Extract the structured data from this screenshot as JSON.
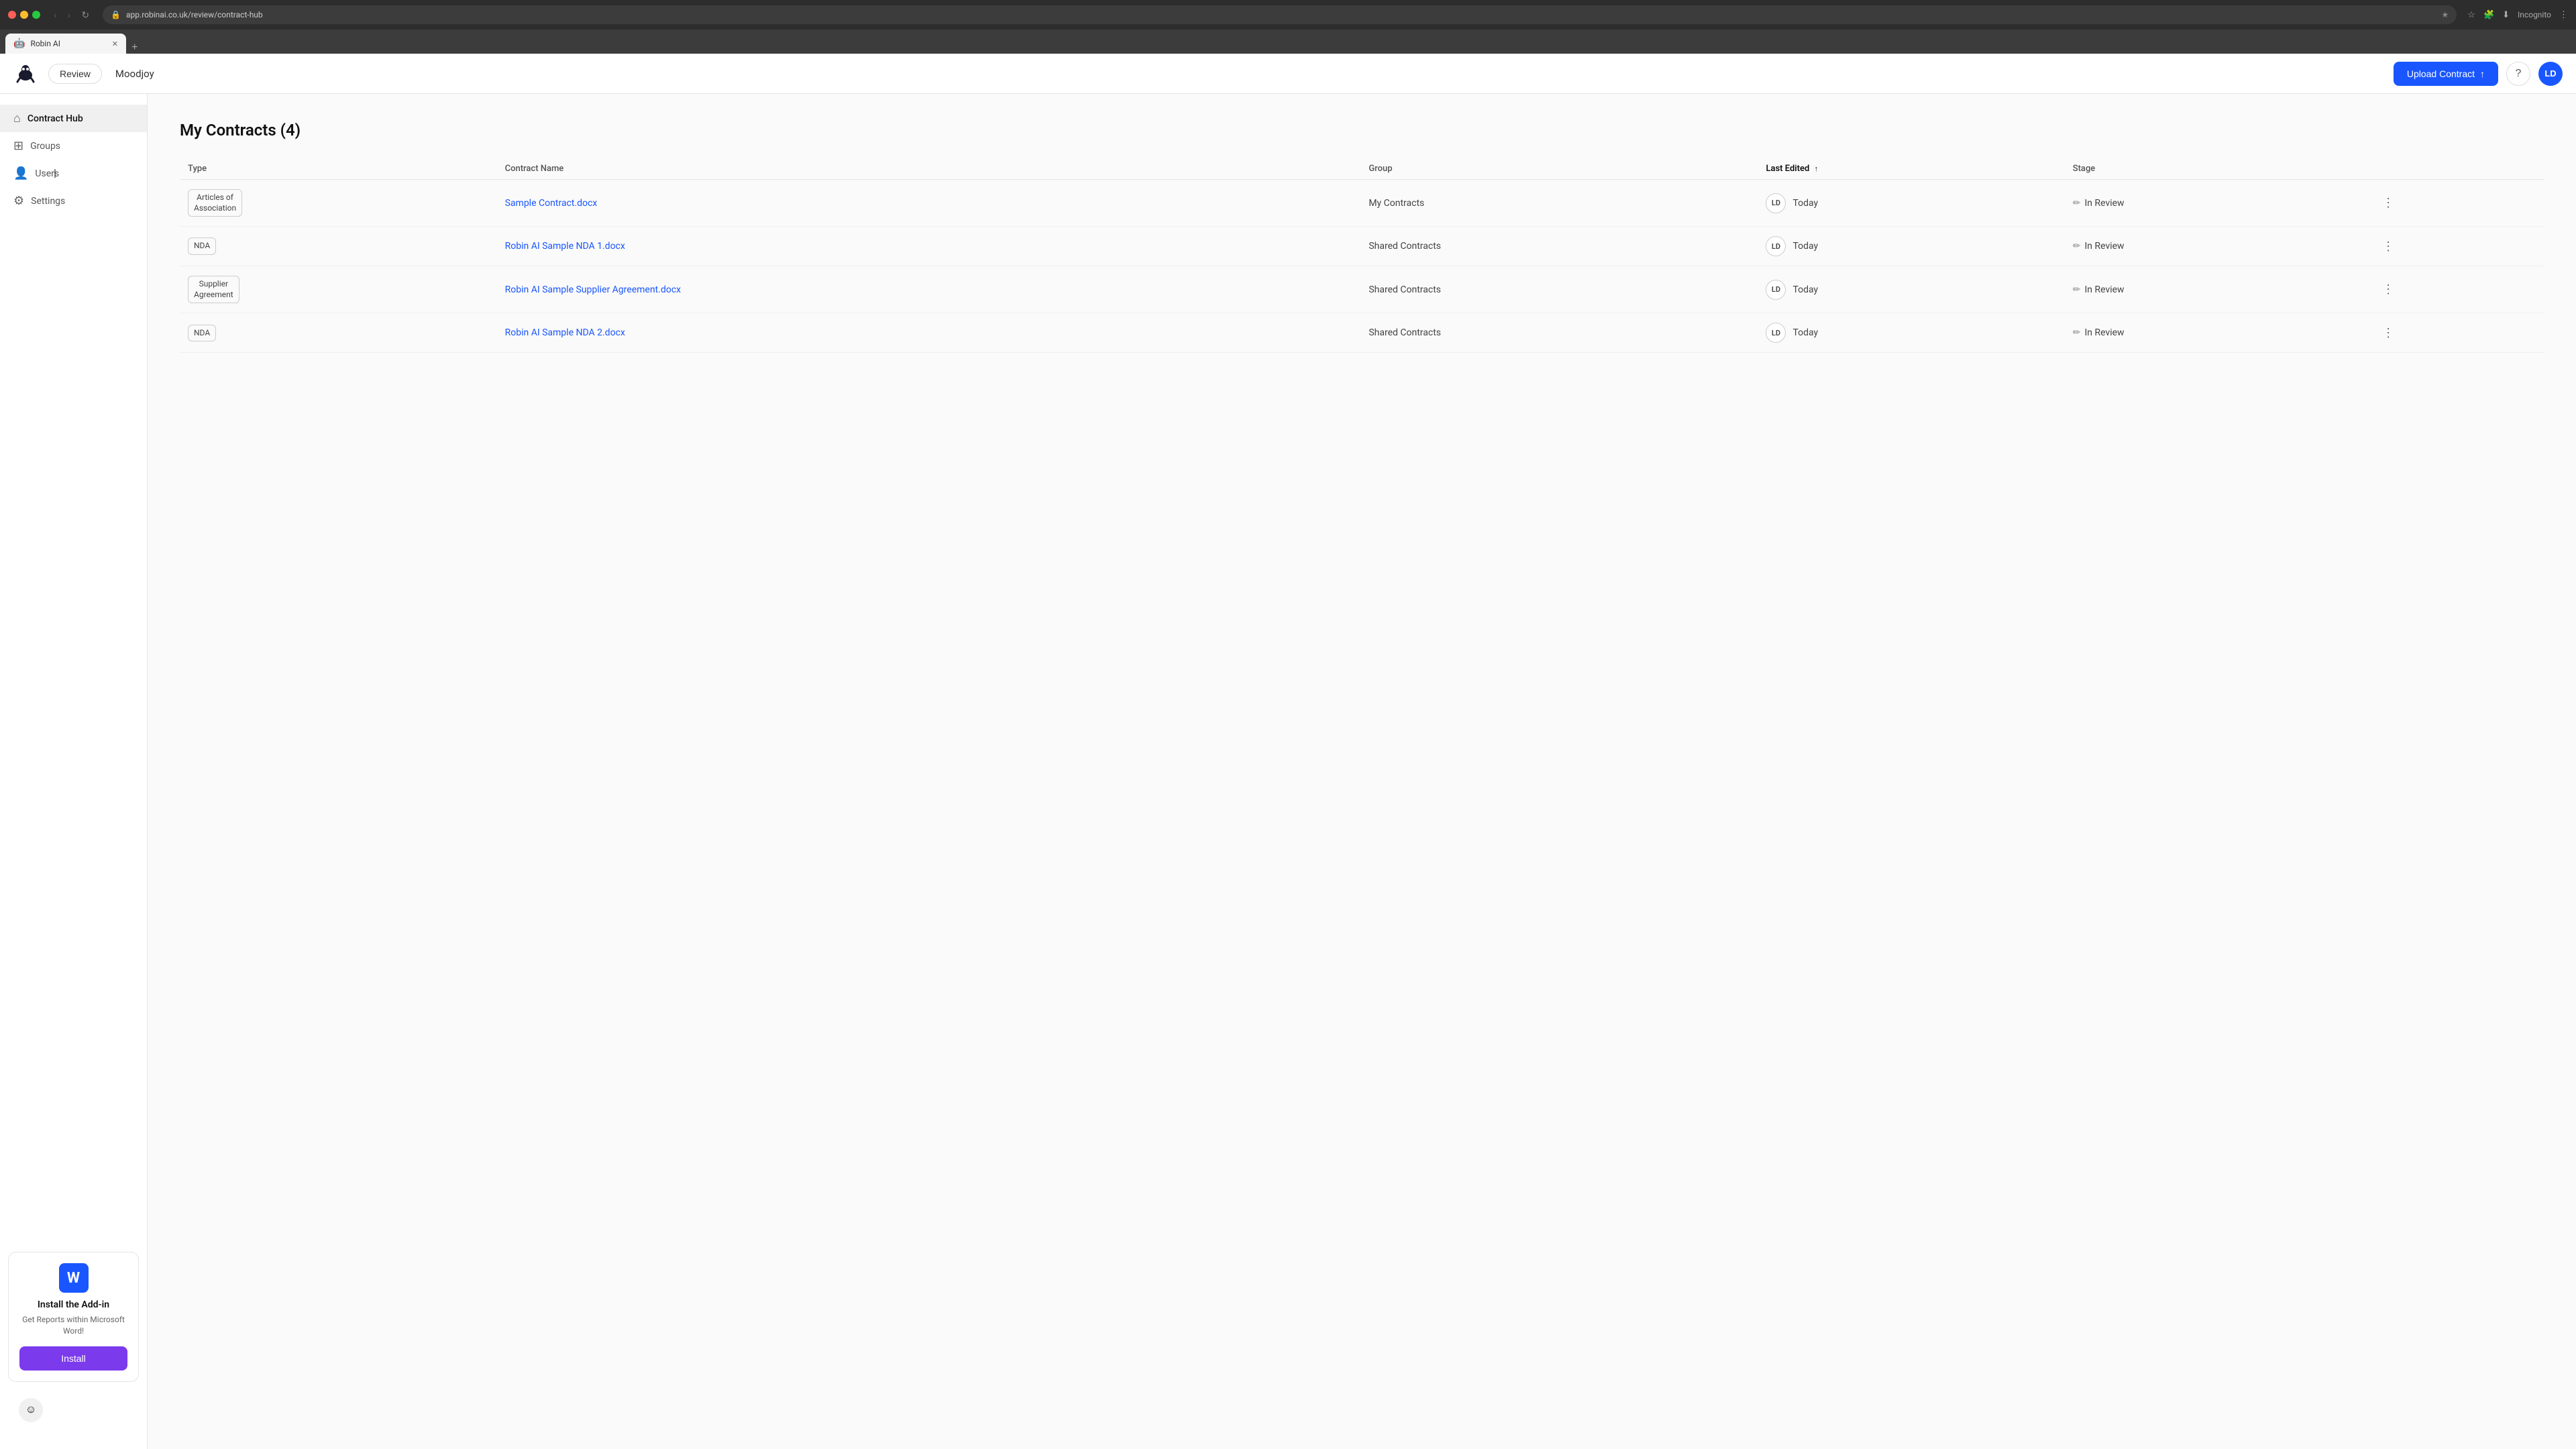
{
  "browser": {
    "url": "app.robinai.co.uk/review/contract-hub",
    "tab_title": "Robin AI",
    "tab_icon": "🤖",
    "incognito_label": "Incognito"
  },
  "header": {
    "logo_alt": "Robin AI bird logo",
    "review_button": "Review",
    "org_name": "Moodjoy",
    "upload_button": "Upload Contract",
    "help_icon": "?",
    "avatar_initials": "LD"
  },
  "sidebar": {
    "items": [
      {
        "id": "contract-hub",
        "label": "Contract Hub",
        "icon": "⌂",
        "active": true
      },
      {
        "id": "groups",
        "label": "Groups",
        "icon": "⊞",
        "active": false
      },
      {
        "id": "users",
        "label": "Users",
        "icon": "👤",
        "active": false
      },
      {
        "id": "settings",
        "label": "Settings",
        "icon": "⚙",
        "active": false
      }
    ],
    "addin": {
      "icon": "W",
      "title": "Install the Add-in",
      "description": "Get Reports within Microsoft Word!",
      "install_button": "Install"
    }
  },
  "main": {
    "page_title": "My Contracts (4)",
    "table": {
      "columns": [
        {
          "id": "type",
          "label": "Type",
          "sorted": false
        },
        {
          "id": "contract_name",
          "label": "Contract Name",
          "sorted": false
        },
        {
          "id": "group",
          "label": "Group",
          "sorted": false
        },
        {
          "id": "last_edited",
          "label": "Last Edited",
          "sorted": true
        },
        {
          "id": "stage",
          "label": "Stage",
          "sorted": false
        }
      ],
      "rows": [
        {
          "type": "Articles of\nAssociation",
          "contract_name": "Sample Contract.docx",
          "group": "My Contracts",
          "last_edited_avatar": "LD",
          "last_edited_date": "Today",
          "stage": "In Review"
        },
        {
          "type": "NDA",
          "contract_name": "Robin AI Sample NDA 1.docx",
          "group": "Shared Contracts",
          "last_edited_avatar": "LD",
          "last_edited_date": "Today",
          "stage": "In Review"
        },
        {
          "type": "Supplier\nAgreement",
          "contract_name": "Robin AI Sample Supplier Agreement.docx",
          "group": "Shared Contracts",
          "last_edited_avatar": "LD",
          "last_edited_date": "Today",
          "stage": "In Review"
        },
        {
          "type": "NDA",
          "contract_name": "Robin AI Sample NDA 2.docx",
          "group": "Shared Contracts",
          "last_edited_avatar": "LD",
          "last_edited_date": "Today",
          "stage": "In Review"
        }
      ]
    }
  }
}
